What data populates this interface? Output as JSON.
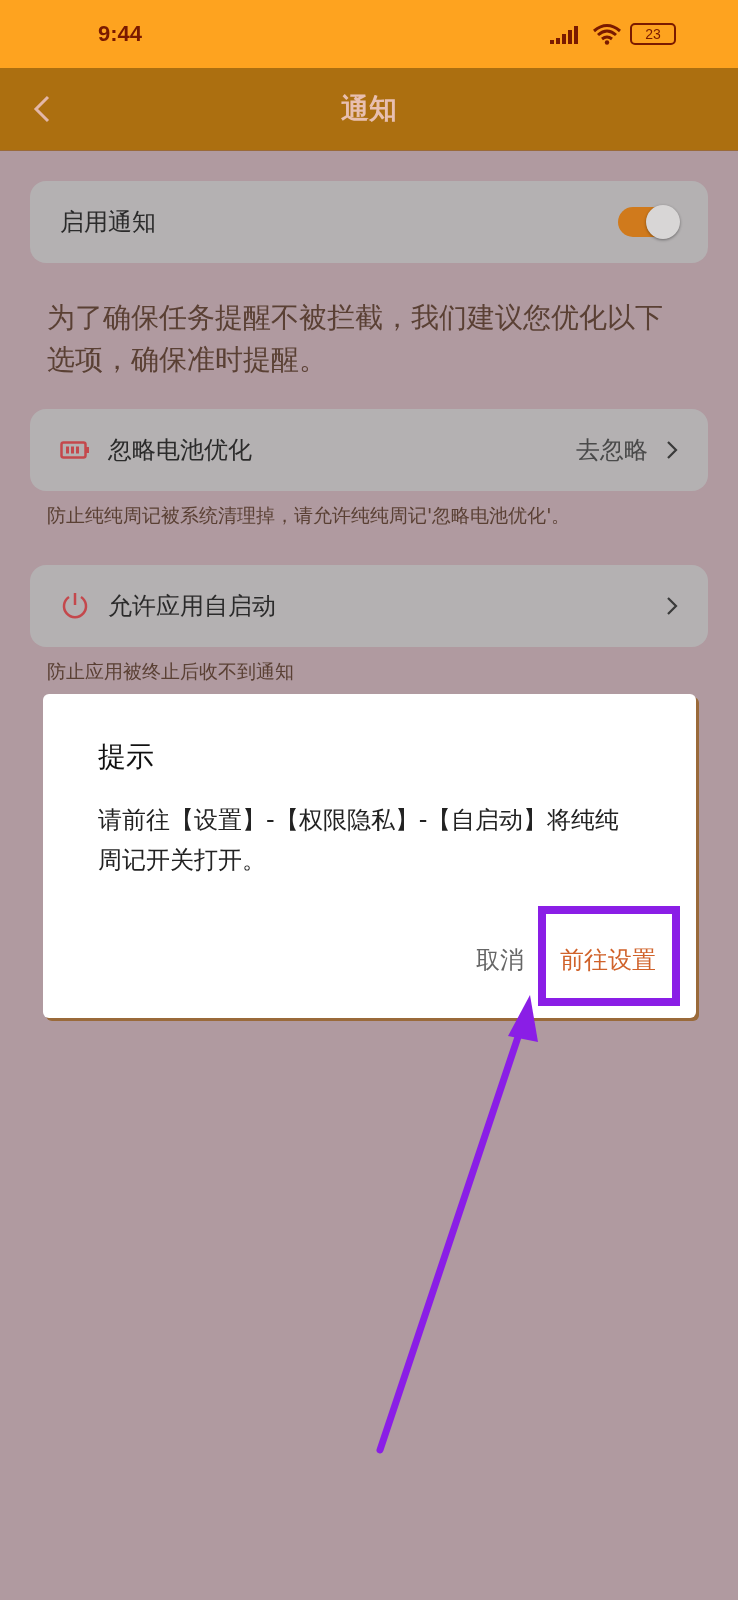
{
  "status_bar": {
    "time": "9:44",
    "battery": "23"
  },
  "app_bar": {
    "title": "通知"
  },
  "enable_row": {
    "label": "启用通知",
    "on": true
  },
  "intro": "为了确保任务提醒不被拦截，我们建议您优化以下选项，确保准时提醒。",
  "options": [
    {
      "kind": "battery",
      "label": "忽略电池优化",
      "action": "去忽略",
      "caption": "防止纯纯周记被系统清理掉，请允许纯纯周记'忽略电池优化'。"
    },
    {
      "kind": "power",
      "label": "允许应用自启动",
      "caption": "防止应用被终止后收不到通知"
    }
  ],
  "dialog": {
    "title": "提示",
    "message": "请前往【设置】-【权限隐私】-【自启动】将纯纯周记开关打开。",
    "buttons": [
      {
        "kind": "cancel",
        "label": "取消"
      },
      {
        "kind": "confirm",
        "label": "前往设置"
      }
    ]
  }
}
